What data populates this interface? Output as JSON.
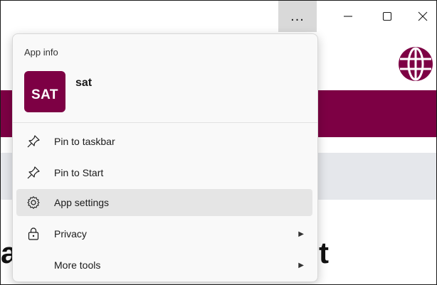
{
  "titlebar": {
    "more_label": "...",
    "minimize_icon": "minimize-icon",
    "maximize_icon": "maximize-icon",
    "close_icon": "close-icon"
  },
  "background": {
    "heading_fragment_left": "a",
    "heading_fragment_right": "t",
    "banner_color": "#7d0044"
  },
  "menu": {
    "header": "App info",
    "app": {
      "logo_text": "SAT",
      "name": "sat",
      "logo_color": "#7d0044"
    },
    "items": [
      {
        "label": "Pin to taskbar",
        "icon": "pin-icon",
        "has_submenu": false
      },
      {
        "label": "Pin to Start",
        "icon": "pin-icon",
        "has_submenu": false
      },
      {
        "label": "App settings",
        "icon": "gear-icon",
        "has_submenu": false,
        "highlighted": true
      },
      {
        "label": "Privacy",
        "icon": "lock-icon",
        "has_submenu": true
      },
      {
        "label": "More tools",
        "icon": "",
        "has_submenu": true
      }
    ]
  }
}
